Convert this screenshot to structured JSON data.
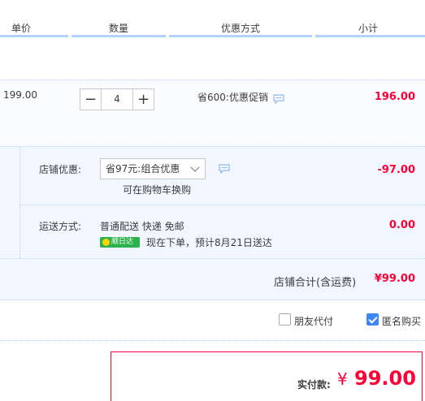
{
  "header": {
    "unit_price": "单价",
    "quantity": "数量",
    "discount_method": "优惠方式",
    "subtotal": "小计"
  },
  "item": {
    "unit_price": "199.00",
    "quantity": "4",
    "minus": "−",
    "plus": "+",
    "promo": "省600:优惠促销",
    "subtotal": "196.00"
  },
  "shop": {
    "discount_label": "店铺优惠:",
    "discount_select": "省97元:组合优惠",
    "discount_note": "可在购物车换购",
    "discount_amount": "-97.00",
    "shipping_label": "运送方式:",
    "shipping_method": "普通配送 快递 免邮",
    "badge": "顺日达",
    "shipping_note": "现在下单，预计8月21日送达",
    "shipping_amount": "0.00",
    "total_label": "店铺合计(含运费)",
    "total_amount": "¥99.00"
  },
  "options": {
    "friend_pay": "朋友代付",
    "anonymous": "匿名购买"
  },
  "pay": {
    "label": "实付款:",
    "currency": "¥",
    "amount": "99.00"
  },
  "colors": {
    "accent_red": "#ff0036",
    "header_line": "#b2d1ff",
    "checkbox_blue": "#3e86f5",
    "badge_green": "#2bb24c"
  }
}
